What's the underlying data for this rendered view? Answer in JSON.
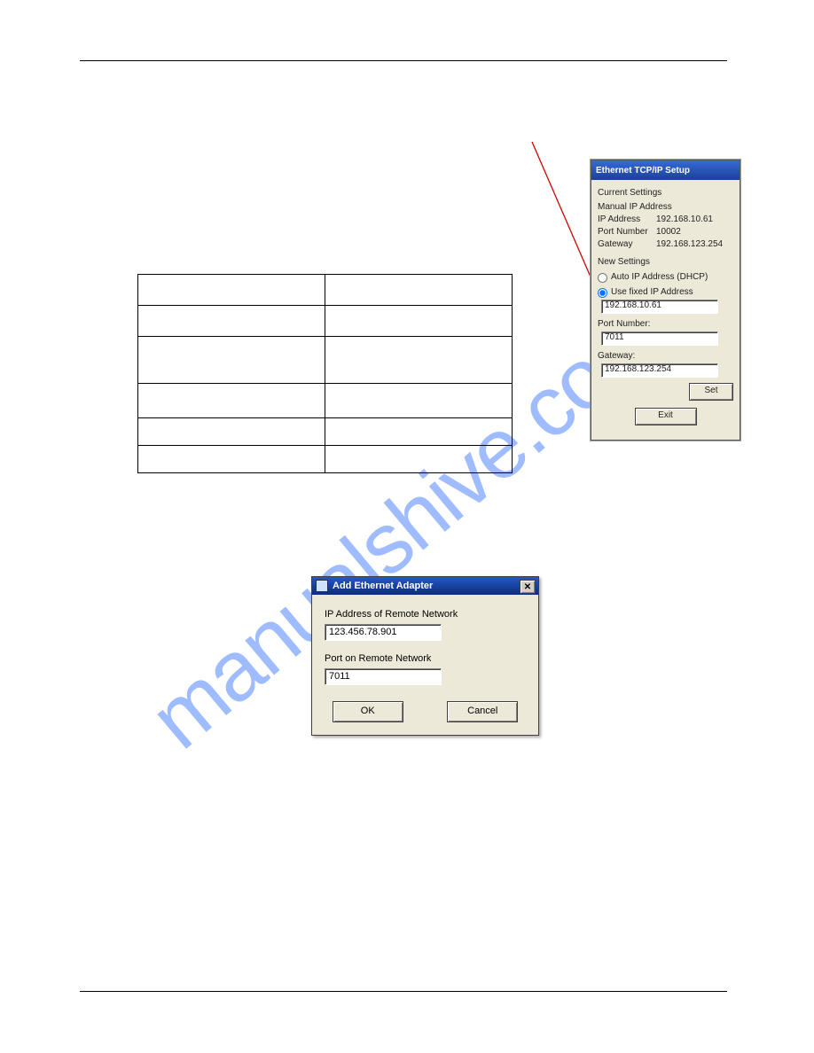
{
  "watermark": "manualshive.com",
  "net_panel": {
    "title": "Ethernet TCP/IP Setup",
    "current_header": "Current Settings",
    "addr_mode_line": "Manual IP Address",
    "rows": {
      "ip_label": "IP Address",
      "ip_value": "192.168.10.61",
      "port_label": "Port Number",
      "port_value": "10002",
      "gateway_label": "Gateway",
      "gateway_value": "192.168.123.254"
    },
    "new_header": "New Settings",
    "radio_auto": "Auto IP Address (DHCP)",
    "radio_fixed": "Use fixed IP Address",
    "fixed_ip_value": "192.168.10.61",
    "port_lbl": "Port Number:",
    "port_input": "7011",
    "gateway_lbl": "Gateway:",
    "gateway_input": "192.168.123.254",
    "set_btn": "Set",
    "exit_btn": "Exit"
  },
  "dialog": {
    "title": "Add Ethernet Adapter",
    "ip_label": "IP Address of Remote Network",
    "ip_value": "123.456.78.901",
    "port_label": "Port on Remote Network",
    "port_value": "7011",
    "ok": "OK",
    "cancel": "Cancel"
  }
}
